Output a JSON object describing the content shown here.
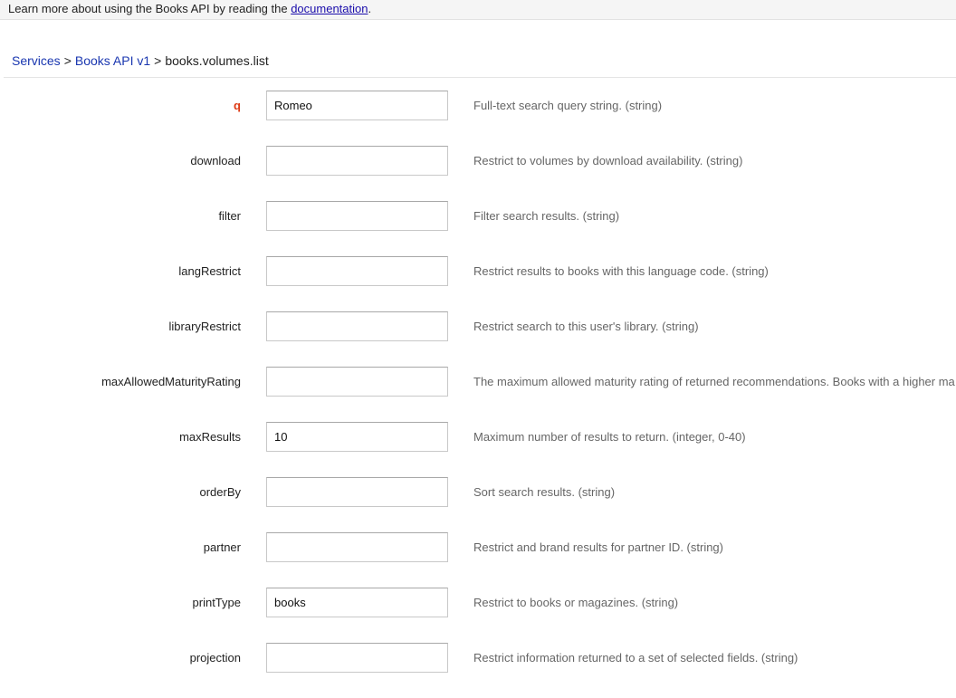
{
  "notice": {
    "text": "Learn more about using the Books API by reading the ",
    "link": "documentation",
    "suffix": "."
  },
  "breadcrumb": {
    "services": "Services",
    "api": "Books API v1",
    "method": "books.volumes.list",
    "sep1": ">",
    "sep2": ">"
  },
  "params": [
    {
      "name": "q",
      "value": "Romeo",
      "required": true,
      "description": "Full-text search query string. (string)"
    },
    {
      "name": "download",
      "value": "",
      "required": false,
      "description": "Restrict to volumes by download availability. (string)"
    },
    {
      "name": "filter",
      "value": "",
      "required": false,
      "description": "Filter search results. (string)"
    },
    {
      "name": "langRestrict",
      "value": "",
      "required": false,
      "description": "Restrict results to books with this language code. (string)"
    },
    {
      "name": "libraryRestrict",
      "value": "",
      "required": false,
      "description": "Restrict search to this user's library. (string)"
    },
    {
      "name": "maxAllowedMaturityRating",
      "value": "",
      "required": false,
      "description": "The maximum allowed maturity rating of returned recommendations. Books with a higher ma"
    },
    {
      "name": "maxResults",
      "value": "10",
      "required": false,
      "description": "Maximum number of results to return. (integer, 0-40)"
    },
    {
      "name": "orderBy",
      "value": "",
      "required": false,
      "description": "Sort search results. (string)"
    },
    {
      "name": "partner",
      "value": "",
      "required": false,
      "description": "Restrict and brand results for partner ID. (string)"
    },
    {
      "name": "printType",
      "value": "books",
      "required": false,
      "description": "Restrict to books or magazines. (string)"
    },
    {
      "name": "projection",
      "value": "",
      "required": false,
      "description": "Restrict information returned to a set of selected fields. (string)"
    }
  ],
  "colors": {
    "link": "#1a37b0",
    "required_label": "#dd3b16",
    "description": "#666666"
  }
}
